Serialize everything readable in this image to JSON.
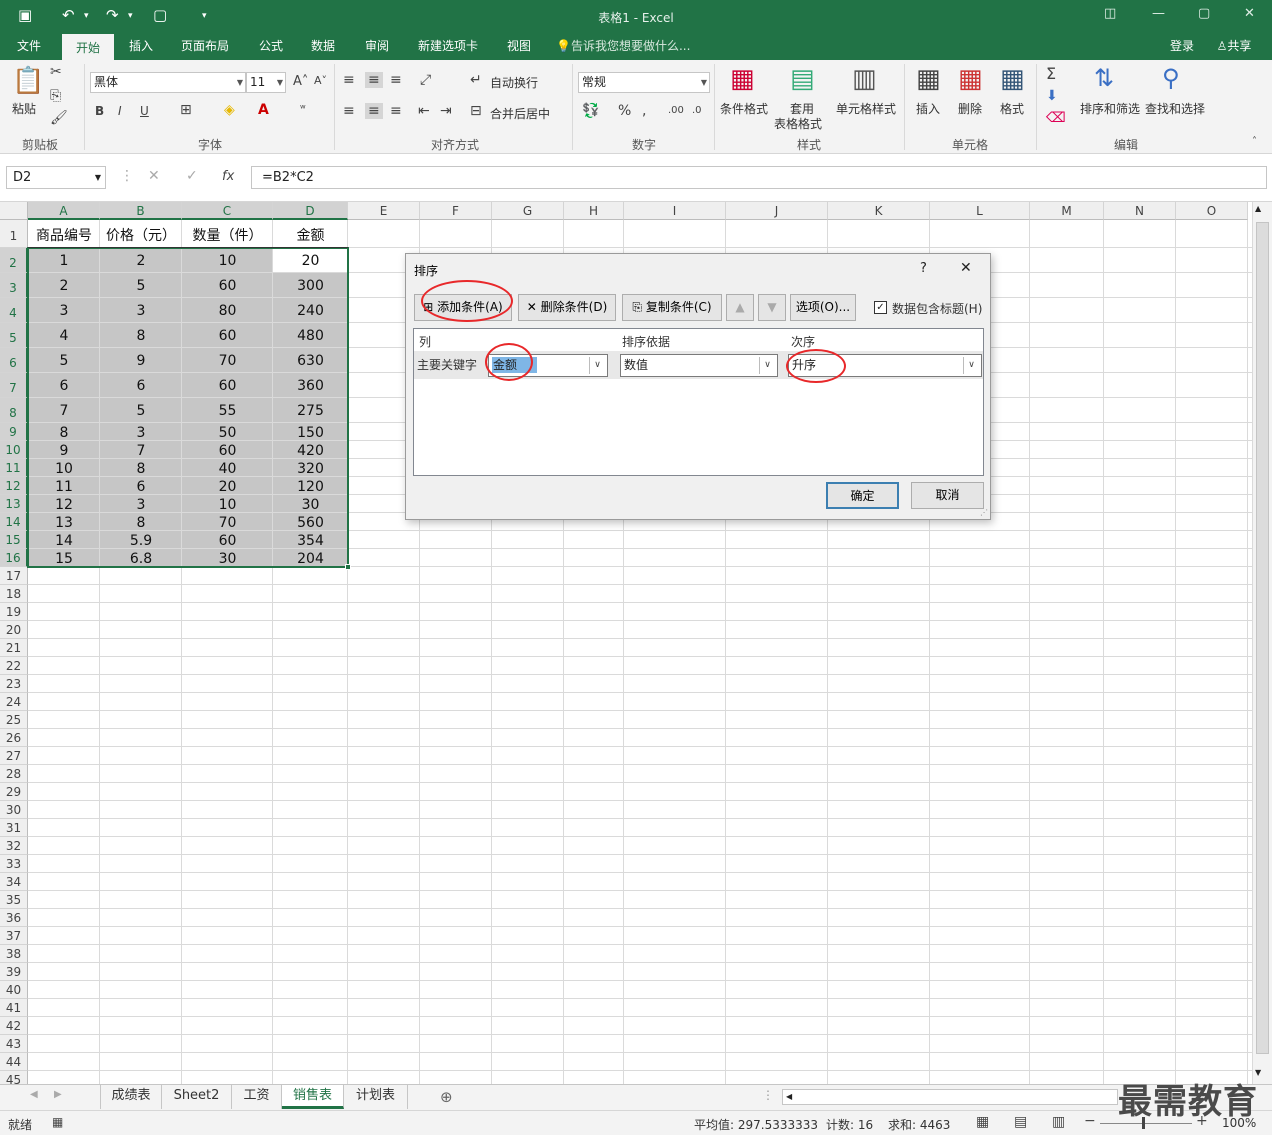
{
  "window": {
    "title": "表格1 - Excel"
  },
  "ribbon_tabs": [
    "文件",
    "开始",
    "插入",
    "页面布局",
    "公式",
    "数据",
    "审阅",
    "新建选项卡",
    "视图"
  ],
  "tell_me": "告诉我您想要做什么...",
  "account": {
    "login": "登录",
    "share": "共享"
  },
  "ribbon": {
    "paste": "粘贴",
    "font_name": "黑体",
    "font_size": "11",
    "wrap_text": "自动换行",
    "merge_center": "合并后居中",
    "number_format": "常规",
    "cond_format": "条件格式",
    "table_format_1": "套用",
    "table_format_2": "表格格式",
    "cell_styles": "单元格样式",
    "insert": "插入",
    "delete": "删除",
    "format": "格式",
    "sort_filter": "排序和筛选",
    "find_select": "查找和选择",
    "groups": {
      "clipboard": "剪贴板",
      "font": "字体",
      "alignment": "对齐方式",
      "number": "数字",
      "styles": "样式",
      "cells": "单元格",
      "editing": "编辑"
    }
  },
  "formula_bar": {
    "name_box": "D2",
    "fx": "fx",
    "formula": "=B2*C2"
  },
  "columns": [
    "A",
    "B",
    "C",
    "D",
    "E",
    "F",
    "G",
    "H",
    "I",
    "J",
    "K",
    "L",
    "M",
    "N",
    "O"
  ],
  "header_row": [
    "商品编号",
    "价格（元）",
    "数量（件）",
    "金额"
  ],
  "rows": [
    [
      "1",
      "2",
      "10",
      "20"
    ],
    [
      "2",
      "5",
      "60",
      "300"
    ],
    [
      "3",
      "3",
      "80",
      "240"
    ],
    [
      "4",
      "8",
      "60",
      "480"
    ],
    [
      "5",
      "9",
      "70",
      "630"
    ],
    [
      "6",
      "6",
      "60",
      "360"
    ],
    [
      "7",
      "5",
      "55",
      "275"
    ],
    [
      "8",
      "3",
      "50",
      "150"
    ],
    [
      "9",
      "7",
      "60",
      "420"
    ],
    [
      "10",
      "8",
      "40",
      "320"
    ],
    [
      "11",
      "6",
      "20",
      "120"
    ],
    [
      "12",
      "3",
      "10",
      "30"
    ],
    [
      "13",
      "8",
      "70",
      "560"
    ],
    [
      "14",
      "5.9",
      "60",
      "354"
    ],
    [
      "15",
      "6.8",
      "30",
      "204"
    ]
  ],
  "sort_dialog": {
    "title": "排序",
    "help": "?",
    "close": "✕",
    "add_level": "添加条件(A)",
    "delete_level": "删除条件(D)",
    "copy_level": "复制条件(C)",
    "options": "选项(O)...",
    "has_headers": "数据包含标题(H)",
    "col_header": "列",
    "sort_on_header": "排序依据",
    "order_header": "次序",
    "primary_key": "主要关键字",
    "column_value": "金额",
    "sort_on_value": "数值",
    "order_value": "升序",
    "ok": "确定",
    "cancel": "取消"
  },
  "sheet_tabs": [
    "成绩表",
    "Sheet2",
    "工资",
    "销售表",
    "计划表"
  ],
  "active_sheet": "销售表",
  "status": {
    "ready": "就绪",
    "average": "平均值: 297.5333333",
    "count": "计数: 16",
    "sum": "求和: 4463",
    "zoom": "100%"
  },
  "watermark": "最需教育"
}
